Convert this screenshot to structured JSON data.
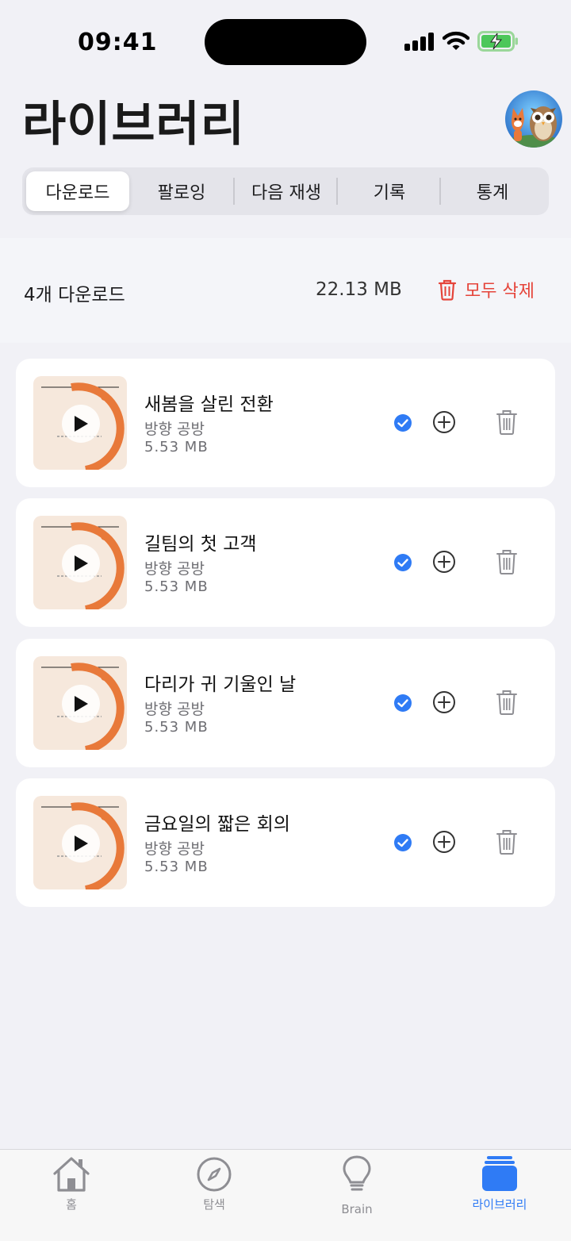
{
  "status_bar": {
    "time": "09:41"
  },
  "header": {
    "title": "라이브러리"
  },
  "segments": [
    {
      "label": "다운로드",
      "active": true
    },
    {
      "label": "팔로잉",
      "active": false
    },
    {
      "label": "다음 재생",
      "active": false
    },
    {
      "label": "기록",
      "active": false
    },
    {
      "label": "통계",
      "active": false
    }
  ],
  "summary": {
    "count_label": "4개 다운로드",
    "total_size": "22.13 MB",
    "delete_all_label": "모두 삭제"
  },
  "downloads": [
    {
      "title": "새봄을 살린 전환",
      "channel": "방향 공방",
      "size": "5.53 MB",
      "downloaded": true
    },
    {
      "title": "길팀의 첫 고객",
      "channel": "방향 공방",
      "size": "5.53 MB",
      "downloaded": true
    },
    {
      "title": "다리가 귀 기울인 날",
      "channel": "방향 공방",
      "size": "5.53 MB",
      "downloaded": true
    },
    {
      "title": "금요일의 짧은 회의",
      "channel": "방향 공방",
      "size": "5.53 MB",
      "downloaded": true
    }
  ],
  "tabbar": {
    "items": [
      {
        "label": "홈",
        "icon": "home-icon",
        "active": false
      },
      {
        "label": "탐색",
        "icon": "compass-icon",
        "active": false
      },
      {
        "label": "Brain",
        "icon": "lightbulb-icon",
        "active": false
      },
      {
        "label": "라이브러리",
        "icon": "library-icon",
        "active": true
      }
    ]
  },
  "colors": {
    "accent": "#2f7bf5",
    "destructive": "#e5443a",
    "background": "#f1f1f6",
    "thumbnail_orange": "#e8793a"
  }
}
